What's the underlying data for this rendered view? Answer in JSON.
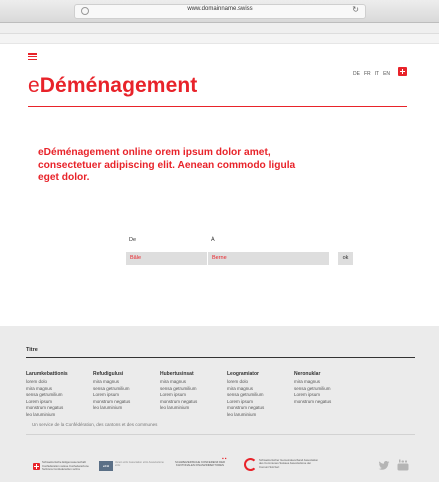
{
  "browser": {
    "url": "www.domainname.swiss",
    "reload_icon": "reload-icon"
  },
  "header": {
    "brand_prefix": "e",
    "brand_main": "Déménagement",
    "languages": [
      "DE",
      "FR",
      "IT",
      "EN"
    ],
    "accent_color": "#e8232a"
  },
  "intro": {
    "text": "eDéménagement online orem ipsum dolor amet, consectetuer adipiscing elit. Aenean commodo ligula eget dolor."
  },
  "form": {
    "from_label": "De",
    "to_label": "À",
    "from_value": "Bâle",
    "to_value": "Berne",
    "ok_label": "ok"
  },
  "footer": {
    "title": "Titre",
    "columns": [
      {
        "heading": "Larumkebattionis",
        "items": [
          "lorem dolo",
          "mira magnus",
          "sensa getrumilium",
          "Lorem ipsum",
          "monstrum negatus",
          "leo laruminium"
        ]
      },
      {
        "heading": "Refudigulusi",
        "items": [
          "mira magnus",
          "sensa getrumilium",
          "Lorem ipsum",
          "monstrum negatus",
          "leo laruminium"
        ]
      },
      {
        "heading": "Hubertusinsat",
        "items": [
          "mira magnus",
          "sensa getrumilium",
          "Lorem ipsum",
          "monstrum negatus",
          "leo laruminium"
        ]
      },
      {
        "heading": "Leogramiator",
        "items": [
          "lorem dolo",
          "mira magnus",
          "sensa getrumilium",
          "Lorem ipsum",
          "monstrum negatus",
          "leo laruminium"
        ]
      },
      {
        "heading": "Neronuklar",
        "items": [
          "mira magnus",
          "sensa getrumilium",
          "Lorem ipsum",
          "monstrum negatus"
        ]
      }
    ],
    "service_text": "Un service de la Confédération, des cantons et des communes",
    "logos": {
      "swiss_text": "Schweizerische Eidgenossenschaft Confédération suisse Confederazione Svizzera Confederaziun svizra",
      "ech_label": "eCH",
      "ech_text": "Verein eCH Association eCH Associazione eCH",
      "conf_text": "SCHWEIZERISCHE KONFERENZ DER KANTONALEN FINANZDIREKTOREN",
      "g_text": "Schweizerischer Gemeindeverband Association des Communes Suisses Associazione dei Comuni Svizzeri"
    },
    "social": [
      "twitter-icon",
      "youtube-icon"
    ]
  }
}
